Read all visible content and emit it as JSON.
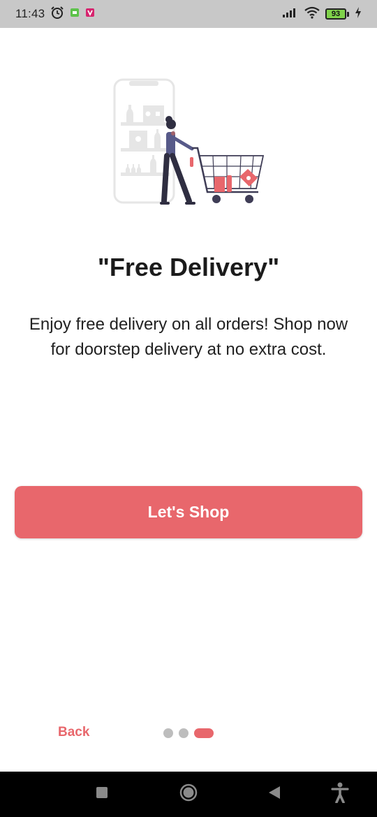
{
  "status_bar": {
    "time": "11:43",
    "battery_level": "93",
    "icons": [
      "alarm-icon",
      "notification-icon",
      "app-icon",
      "signal-icon",
      "wifi-icon",
      "battery-icon",
      "charging-icon"
    ]
  },
  "onboarding": {
    "title": "\"Free Delivery\"",
    "description": "Enjoy free delivery on all orders! Shop now for doorstep delivery at no extra cost.",
    "primary_button": "Let's Shop",
    "back_label": "Back",
    "page_indicator": {
      "total": 3,
      "current": 3
    }
  },
  "colors": {
    "accent": "#e8676c",
    "status_bar_bg": "#c8c8c8",
    "text": "#1b1b1b",
    "dot_inactive": "#bdbdbd",
    "nav_bar_bg": "#000000"
  }
}
